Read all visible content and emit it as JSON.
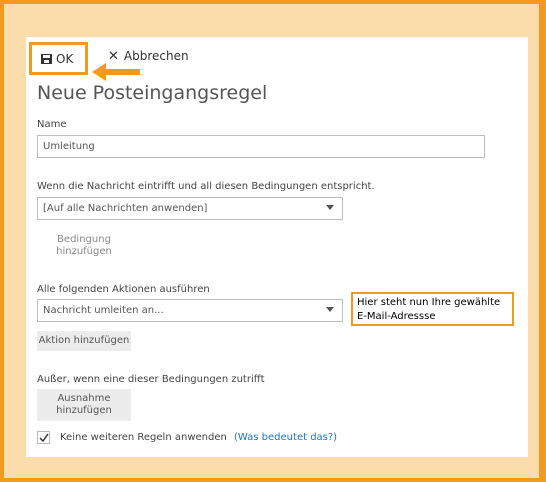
{
  "toolbar": {
    "ok_label": "OK",
    "cancel_label": "Abbrechen"
  },
  "form": {
    "title": "Neue Posteingangsregel",
    "name_label": "Name",
    "name_value": "Umleitung",
    "condition_label": "Wenn die Nachricht eintrifft und all diesen Bedingungen entspricht.",
    "condition_value": "[Auf alle Nachrichten anwenden]",
    "add_condition_label": "Bedingung\nhinzufügen",
    "actions_label": "Alle folgenden Aktionen ausführen",
    "action_value": "Nachricht umleiten an...",
    "add_action_label": "Aktion hinzufügen",
    "exception_label": "Außer, wenn eine dieser Bedingungen zutrifft",
    "add_exception_label": "Ausnahme\nhinzufügen",
    "stop_rules_label": "Keine weiteren Regeln anwenden",
    "stop_rules_checked": true,
    "help_link": "(Was bedeutet das?)"
  },
  "annotation": {
    "callout_text": "Hier steht nun Ihre gewählte E-Mail-Adressse"
  },
  "colors": {
    "accent_orange": "#f39a1e",
    "background_peach": "#fbdcab",
    "link_blue": "#1a73c7"
  }
}
